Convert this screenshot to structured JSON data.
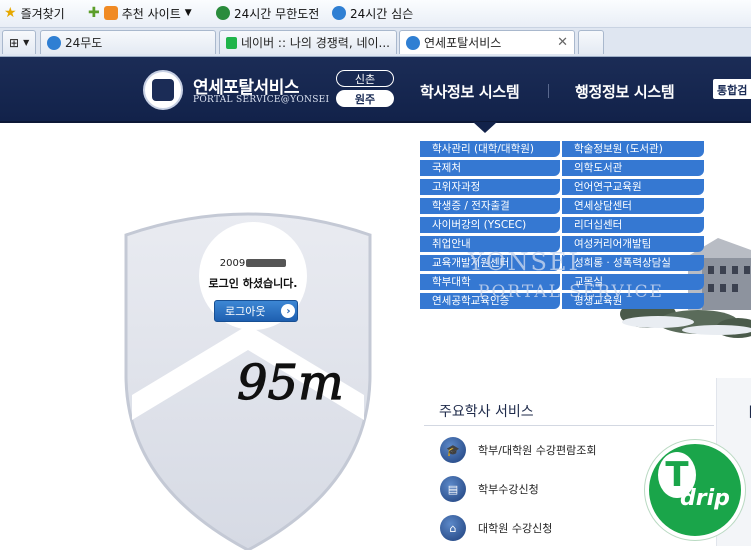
{
  "favorites_bar": {
    "favorites_label": "즐겨찾기",
    "recommended_label": "추천 사이트",
    "link1": "24시간 무한도전",
    "link2": "24시간 심슨"
  },
  "tabs": [
    {
      "label": "24무도"
    },
    {
      "label": "네이버 :: 나의 경쟁력, 네이..."
    },
    {
      "label": "연세포탈서비스"
    }
  ],
  "header": {
    "brand_ko": "연세포탈서비스",
    "brand_en": "PORTAL SERVICE@YONSEI",
    "campus_options": [
      "신촌",
      "원주"
    ],
    "nav": [
      "학사정보 시스템",
      "행정정보 시스템"
    ],
    "integrated": "통합검"
  },
  "login": {
    "user_id": "2009",
    "message": "로그인 하셨습니다.",
    "logout_label": "로그아웃"
  },
  "menu": {
    "left": [
      "학사관리 (대학/대학원)",
      "국제처",
      "고위자과정",
      "학생증 / 전자출결",
      "사이버강의 (YSCEC)",
      "취업안내",
      "교육개발지원센터",
      "학부대학",
      "연세공학교육인증"
    ],
    "right": [
      "학술정보원 (도서관)",
      "의학도서관",
      "언어연구교육원",
      "연세상담센터",
      "리더십센터",
      "여성커리어개발팀",
      "성희롱 · 성폭력상담실",
      "교목실",
      "평생교육원"
    ]
  },
  "watermark": {
    "line1": "YONSEI",
    "line2": "PORTAL SERVICE"
  },
  "services": {
    "title": "주요학사 서비스",
    "items": [
      {
        "label": "학부/대학원 수강편람조회",
        "icon": "graduation-cap-icon"
      },
      {
        "label": "학부수강신청",
        "icon": "book-icon"
      },
      {
        "label": "대학원 수강신청",
        "icon": "building-icon"
      }
    ]
  },
  "handwritten": "95m",
  "badge": {
    "letter": "T",
    "text": "drip"
  },
  "colors": {
    "header_bg": "#1b2c56",
    "menu_blue": "#3578d2",
    "badge_green": "#1aa54a"
  }
}
